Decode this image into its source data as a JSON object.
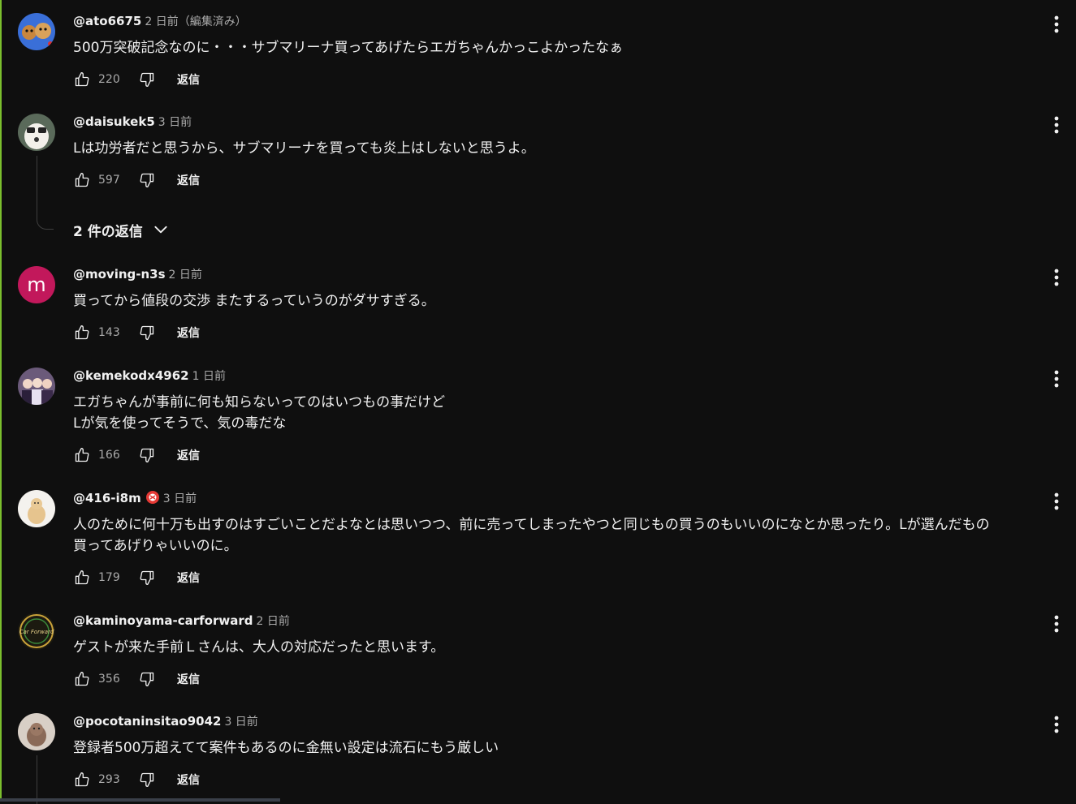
{
  "reply_label": "返信",
  "comments": [
    {
      "handle": "@ato6675",
      "time": "2 日前（編集済み）",
      "text": "500万突破記念なのに・・・サブマリーナ買ってあげたらエガちゃんかっこよかったなぁ",
      "likes": "220"
    },
    {
      "handle": "@daisukek5",
      "time": "3 日前",
      "text": "Lは功労者だと思うから、サブマリーナを買っても炎上はしないと思うよ。",
      "likes": "597",
      "replies_label": "2 件の返信"
    },
    {
      "handle": "@moving-n3s",
      "time": "2 日前",
      "avatar_letter": "m",
      "text": "買ってから値段の交渉 またするっていうのがダサすぎる。",
      "likes": "143"
    },
    {
      "handle": "@kemekodx4962",
      "time": "1 日前",
      "text_line1": "エガちゃんが事前に何も知らないってのはいつもの事だけど",
      "text_line2": "Lが気を使ってそうで、気の毒だな",
      "likes": "166"
    },
    {
      "handle": "@416-i8m",
      "time": "3 日前",
      "text_line1": "人のために何十万も出すのはすごいことだよなとは思いつつ、前に売ってしまったやつと同じもの買うのもいいのになとか思ったり。Lが選んだもの",
      "text_line2": "買ってあげりゃいいのに。",
      "likes": "179"
    },
    {
      "handle": "@kaminoyama-carforward",
      "time": "2 日前",
      "avatar_text": "Car Forward",
      "text": "ゲストが来た手前Ｌさんは、大人の対応だったと思います。",
      "likes": "356"
    },
    {
      "handle": "@pocotaninsitao9042",
      "time": "3 日前",
      "text": "登録者500万超えてて案件もあるのに金無い設定は流石にもう厳しい",
      "likes": "293"
    }
  ],
  "colors": {
    "background": "#0f0f0f",
    "text": "#f1f1f1",
    "secondary_text": "#aaaaaa",
    "accent_left_border": "#7bbf2e",
    "avatar_m": "#c2185b"
  },
  "icons": [
    "like-icon",
    "dislike-icon",
    "more-vert-icon",
    "chevron-down-icon",
    "badge-icon"
  ]
}
